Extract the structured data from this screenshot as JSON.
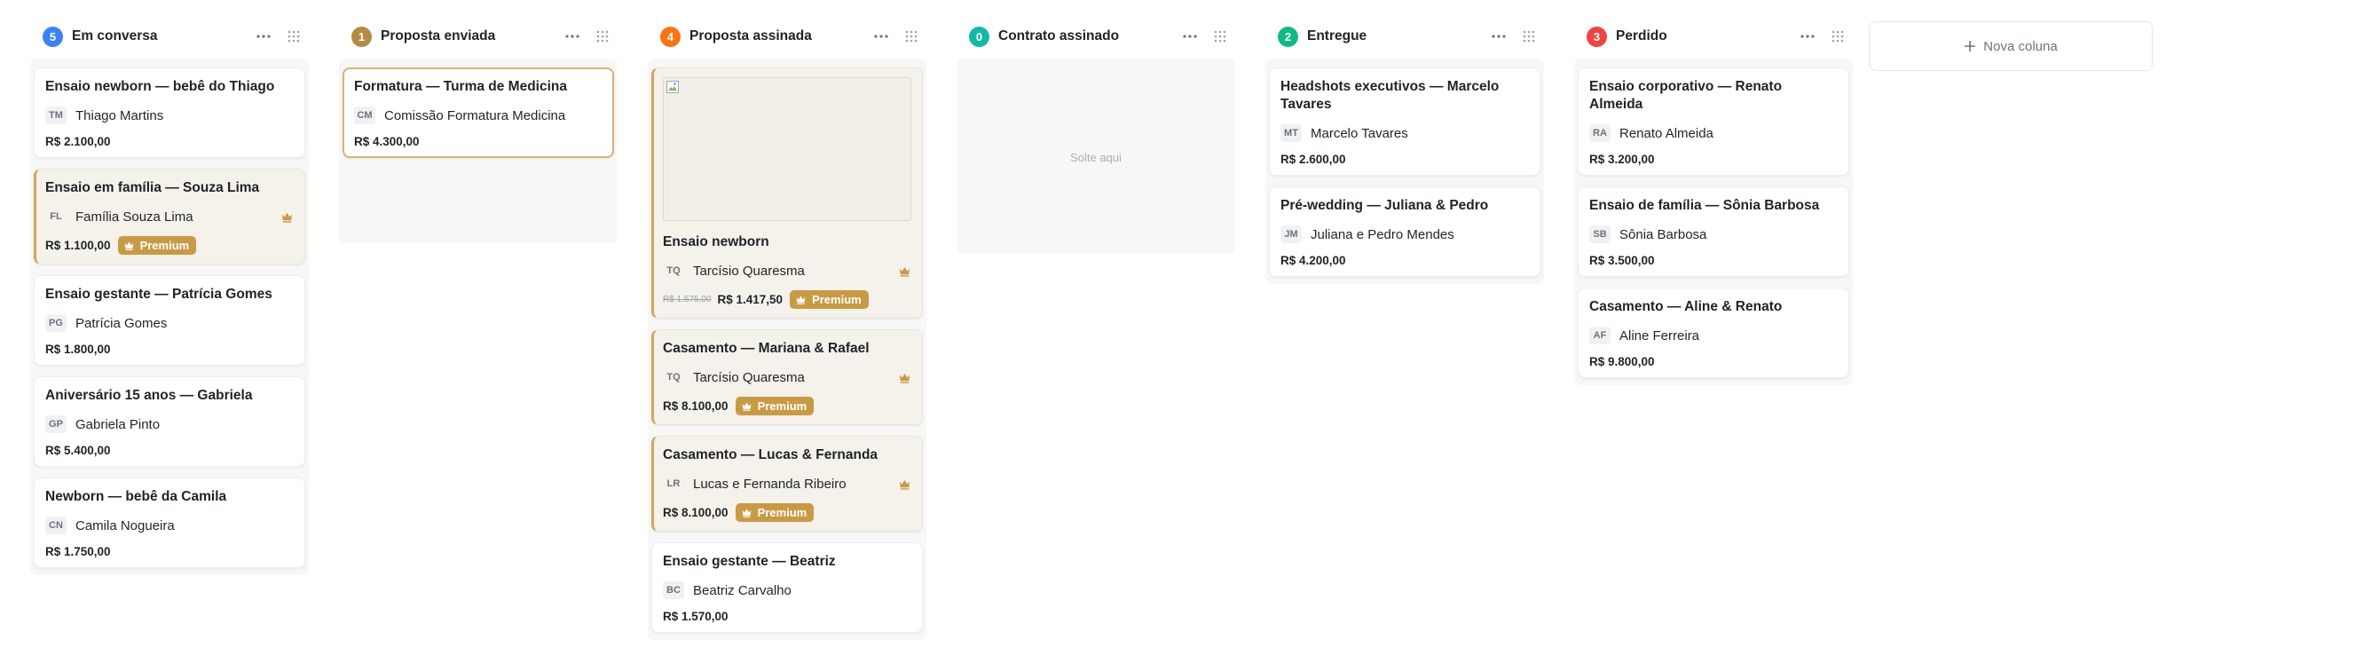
{
  "columns": [
    {
      "count": "5",
      "title": "Em conversa",
      "count_color": "#3b82f6",
      "cards": [
        {
          "title": "Ensaio newborn — bebê do Thiago",
          "initials": "TM",
          "client": "Thiago Martins",
          "price": "R$ 2.100,00"
        },
        {
          "title": "Ensaio em família — Souza Lima",
          "initials": "FL",
          "client": "Família Souza Lima",
          "price": "R$ 1.100,00",
          "badge": "Premium",
          "premium": true
        },
        {
          "title": "Ensaio gestante — Patrícia Gomes",
          "initials": "PG",
          "client": "Patrícia Gomes",
          "price": "R$ 1.800,00"
        },
        {
          "title": "Aniversário 15 anos — Gabriela",
          "initials": "GP",
          "client": "Gabriela Pinto",
          "price": "R$ 5.400,00"
        },
        {
          "title": "Newborn — bebê da Camila",
          "initials": "CN",
          "client": "Camila Nogueira",
          "price": "R$ 1.750,00"
        }
      ]
    },
    {
      "count": "1",
      "title": "Proposta enviada",
      "count_color": "#b58a45",
      "cards": [
        {
          "title": "Formatura — Turma de Medicina",
          "initials": "CM",
          "client": "Comissão Formatura Medicina",
          "price": "R$ 4.300,00",
          "selected": true
        }
      ]
    },
    {
      "count": "4",
      "title": "Proposta assinada",
      "count_color": "#f97316",
      "cards": [
        {
          "title": "Ensaio newborn",
          "initials": "TQ",
          "client": "Tarcísio Quaresma",
          "old_price": "R$ 1.575,00",
          "price": "R$ 1.417,50",
          "badge": "Premium",
          "premium": true,
          "image": true
        },
        {
          "title": "Casamento — Mariana & Rafael",
          "initials": "TQ",
          "client": "Tarcísio Quaresma",
          "price": "R$ 8.100,00",
          "badge": "Premium",
          "premium": true
        },
        {
          "title": "Casamento — Lucas & Fernanda",
          "initials": "LR",
          "client": "Lucas e Fernanda Ribeiro",
          "price": "R$ 8.100,00",
          "badge": "Premium",
          "premium": true
        },
        {
          "title": "Ensaio gestante — Beatriz",
          "initials": "BC",
          "client": "Beatriz Carvalho",
          "price": "R$ 1.570,00"
        }
      ]
    },
    {
      "count": "0",
      "title": "Contrato assinado",
      "count_color": "#14b8a6",
      "drop_text": "Solte aqui",
      "cards": []
    },
    {
      "count": "2",
      "title": "Entregue",
      "count_color": "#10b981",
      "cards": [
        {
          "title": "Headshots executivos — Marcelo Tavares",
          "initials": "MT",
          "client": "Marcelo Tavares",
          "price": "R$ 2.600,00"
        },
        {
          "title": "Pré-wedding — Juliana & Pedro",
          "initials": "JM",
          "client": "Juliana e Pedro Mendes",
          "price": "R$ 4.200,00"
        }
      ]
    },
    {
      "count": "3",
      "title": "Perdido",
      "count_color": "#ef4444",
      "cards": [
        {
          "title": "Ensaio corporativo — Renato Almeida",
          "initials": "RA",
          "client": "Renato Almeida",
          "price": "R$ 3.200,00"
        },
        {
          "title": "Ensaio de família — Sônia Barbosa",
          "initials": "SB",
          "client": "Sônia Barbosa",
          "price": "R$ 3.500,00"
        },
        {
          "title": "Casamento — Aline & Renato",
          "initials": "AF",
          "client": "Aline Ferreira",
          "price": "R$ 9.800,00"
        }
      ]
    }
  ],
  "new_column_label": "Nova coluna",
  "icons": {
    "more": "more-horizontal-icon",
    "drag": "drag-handle-icon",
    "premium": "crown-icon",
    "add": "plus-icon",
    "broken_image": "broken-image-icon"
  },
  "colors": {
    "premium_accent": "#c99a45",
    "premium_card_bg": "#f5f1eb"
  }
}
